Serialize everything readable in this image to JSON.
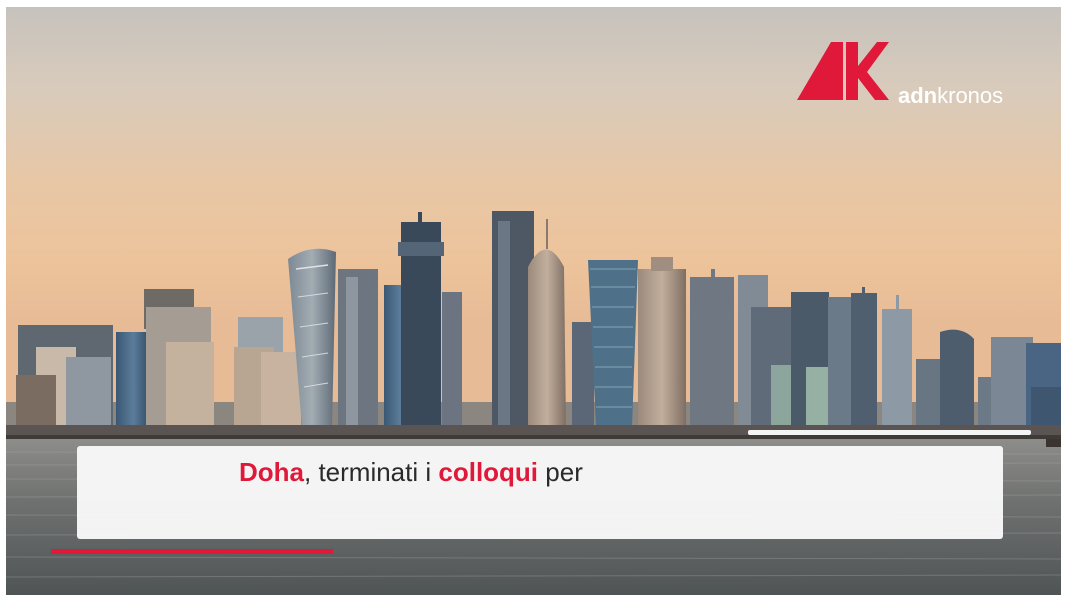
{
  "brand": {
    "name_bold": "adn",
    "name_regular": "kronos",
    "accent_color": "#e0193a"
  },
  "caption": {
    "part1": "Doha",
    "part2": ", terminati i ",
    "part3": "colloqui",
    "part4": " per"
  },
  "scene": {
    "description_icon": "city-skyline-icon"
  }
}
